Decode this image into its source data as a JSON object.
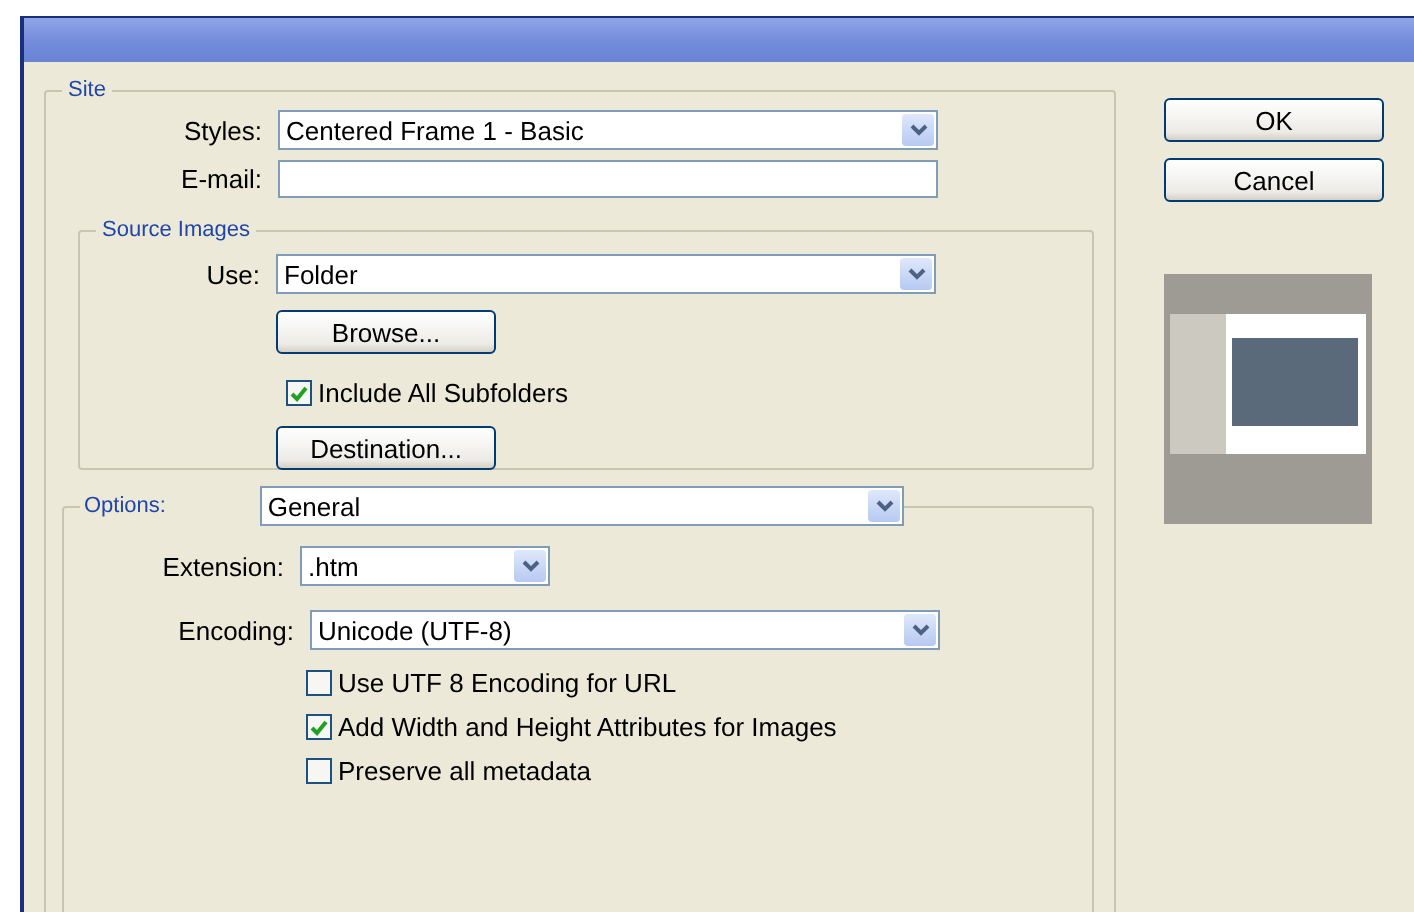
{
  "site": {
    "legend": "Site",
    "styles": {
      "label": "Styles:",
      "value": "Centered Frame 1 - Basic"
    },
    "email": {
      "label": "E-mail:"
    },
    "source_images": {
      "legend": "Source Images",
      "use": {
        "label": "Use:",
        "value": "Folder"
      },
      "browse_button": "Browse...",
      "include_subfolders": {
        "label": "Include All Subfolders",
        "checked": true
      },
      "destination_button": "Destination..."
    },
    "options": {
      "label": "Options:",
      "value": "General",
      "extension": {
        "label": "Extension:",
        "value": ".htm"
      },
      "encoding": {
        "label": "Encoding:",
        "value": "Unicode (UTF-8)"
      },
      "checkboxes": [
        {
          "label": "Use UTF 8 Encoding for URL",
          "checked": false
        },
        {
          "label": "Add Width and Height Attributes for Images",
          "checked": true
        },
        {
          "label": "Preserve all metadata",
          "checked": false
        }
      ]
    }
  },
  "buttons": [
    "OK",
    "Cancel"
  ]
}
